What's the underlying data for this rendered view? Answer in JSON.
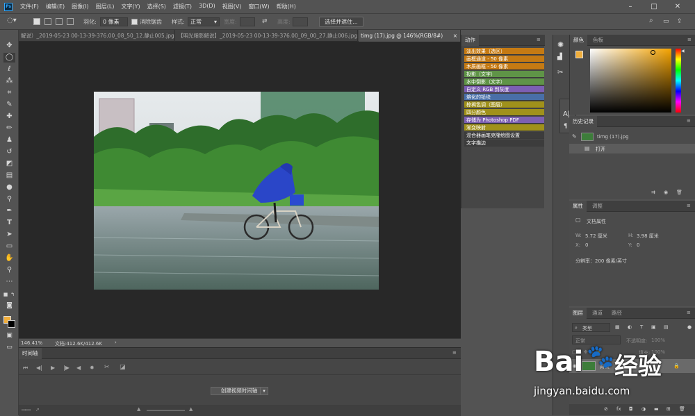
{
  "app": {
    "logo": "Ps"
  },
  "menu": [
    "文件(F)",
    "编辑(E)",
    "图像(I)",
    "图层(L)",
    "文字(Y)",
    "选择(S)",
    "滤镜(T)",
    "3D(D)",
    "视图(V)",
    "窗口(W)",
    "帮助(H)"
  ],
  "options": {
    "feather_label": "羽化:",
    "feather_value": "0 像素",
    "antialias_label": "消除锯齿",
    "style_label": "样式:",
    "style_value": "正常",
    "width_label": "宽度:",
    "height_label": "高度:",
    "select_mask_button": "选择并遮住..."
  },
  "doc_tabs": [
    {
      "label": "解说）_2019-05-23 00-13-39-376.00_08_50_12.静止005.jpg",
      "active": false
    },
    {
      "label": "【明光粮影解说】_2019-05-23 00-13-39-376.00_09_00_27.静止006.jpg",
      "active": false
    },
    {
      "label": "timg (17).jpg @ 146%(RGB/8#)",
      "active": true
    }
  ],
  "status": {
    "zoom": "146.41%",
    "doc_info": "文档:412.6K/412.6K"
  },
  "timeline": {
    "title": "时间轴",
    "create_button": "创建视频时间轴"
  },
  "actions": {
    "title": "动作",
    "items": [
      {
        "label": "淡出效果（选区）",
        "color": "#c57a13"
      },
      {
        "label": "画框通道 - 50 像素",
        "color": "#c57a13"
      },
      {
        "label": "木质画框 - 50 像素",
        "color": "#c57a13"
      },
      {
        "label": "投影（文字）",
        "color": "#5f9447"
      },
      {
        "label": "水中倒影（文字）",
        "color": "#5f9447"
      },
      {
        "label": "自定义 RGB 到灰度",
        "color": "#7c5fb3"
      },
      {
        "label": "熔化的铅块",
        "color": "#496fa8"
      },
      {
        "label": "棕褐色调（图层）",
        "color": "#a0911b"
      },
      {
        "label": "四分颜色",
        "color": "#a0911b"
      },
      {
        "label": "存储为 Photoshop PDF",
        "color": "#7c5fb3"
      },
      {
        "label": "渐变映射",
        "color": "#a0911b"
      },
      {
        "label": "混合器画笔克隆绘图设置",
        "color": "#3c3c3c"
      },
      {
        "label": "文字描边",
        "color": "#3c3c3c"
      }
    ]
  },
  "color_panel": {
    "tabs": [
      "颜色",
      "色板"
    ],
    "fg": "#f1ae3b",
    "bg": "#000000"
  },
  "history": {
    "title": "历史记录",
    "snapshot": "timg (17).jpg",
    "step": "打开"
  },
  "properties": {
    "tabs": [
      "属性",
      "调整"
    ],
    "doc_label": "文档属性",
    "w_label": "W:",
    "w_value": "5.72 厘米",
    "h_label": "H:",
    "h_value": "3.98 厘米",
    "x_label": "X:",
    "x_value": "0",
    "y_label": "Y:",
    "y_value": "0",
    "resolution": "分辨率：200 像素/英寸"
  },
  "layers": {
    "tabs": [
      "图层",
      "通道",
      "路径"
    ],
    "filter_label": "类型",
    "mode": "正常",
    "opacity_label": "不透明度:",
    "opacity_value": "100%",
    "fill_label": "填充:",
    "fill_value": "100%",
    "layer_name": "背景"
  },
  "watermark": {
    "brand": "Bai",
    "brand2": "经验",
    "url": "jingyan.baidu.com"
  }
}
